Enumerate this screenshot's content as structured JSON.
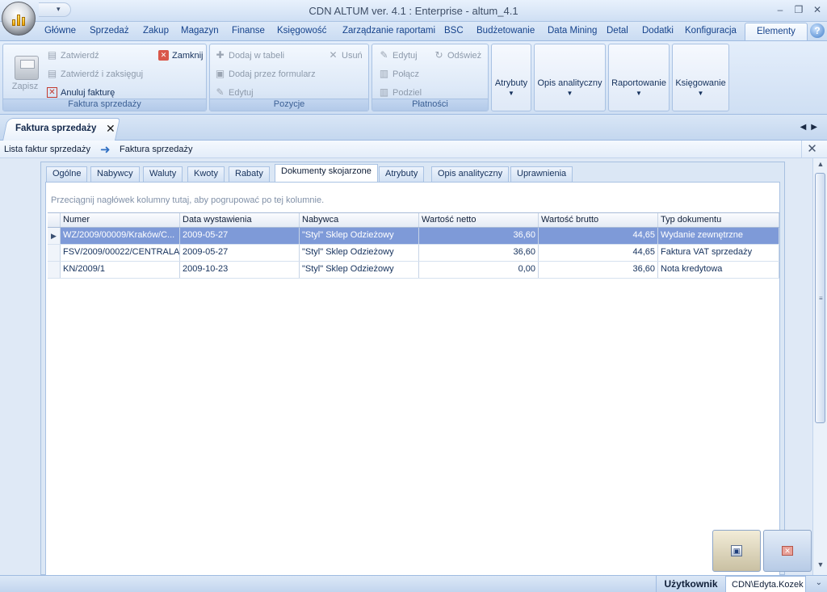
{
  "window": {
    "title": "CDN ALTUM ver. 4.1 : Enterprise - altum_4.1",
    "minimize": "–",
    "restore": "❐",
    "close": "✕"
  },
  "ribbon_tabs": [
    "Główne",
    "Sprzedaż",
    "Zakup",
    "Magazyn",
    "Finanse",
    "Księgowość",
    "Zarządzanie raportami",
    "BSC",
    "Budżetowanie",
    "Data Mining",
    "Detal",
    "Dodatki",
    "Konfiguracja",
    "Elementy"
  ],
  "ribbon_active_tab": "Elementy",
  "help_label": "?",
  "ribbon": {
    "faktura": {
      "label": "Faktura sprzedaży",
      "save": "Zapisz",
      "approve": "Zatwierdź",
      "approve_post": "Zatwierdź i zaksięguj",
      "cancel_invoice": "Anuluj fakturę",
      "close": "Zamknij"
    },
    "pozycje": {
      "label": "Pozycje",
      "add_table": "Dodaj w tabeli",
      "add_form": "Dodaj przez formularz",
      "edit": "Edytuj",
      "delete": "Usuń"
    },
    "platnosci": {
      "label": "Płatności",
      "edit": "Edytuj",
      "refresh": "Odśwież",
      "merge": "Połącz",
      "split": "Podziel"
    },
    "dropdowns": [
      "Atrybuty",
      "Opis analityczny",
      "Raportowanie",
      "Księgowanie"
    ]
  },
  "document_tab": {
    "label": "Faktura sprzedaży",
    "close": "✕"
  },
  "breadcrumb": {
    "parent": "Lista faktur sprzedaży",
    "current": "Faktura sprzedaży",
    "close": "✕"
  },
  "panel_tabs": [
    "Ogólne",
    "Nabywcy",
    "Waluty",
    "Kwoty",
    "Rabaty",
    "Dokumenty skojarzone",
    "Atrybuty",
    "Opis analityczny",
    "Uprawnienia"
  ],
  "panel_active_tab": "Dokumenty skojarzone",
  "grid": {
    "group_hint": "Przeciągnij nagłówek kolumny tutaj, aby pogrupować po tej kolumnie.",
    "columns": [
      "Numer",
      "Data wystawienia",
      "Nabywca",
      "Wartość netto",
      "Wartość brutto",
      "Typ dokumentu"
    ],
    "rows": [
      {
        "numer": "WZ/2009/00009/Kraków/C...",
        "data": "2009-05-27",
        "nabywca": "\"Styl\" Sklep Odzieżowy",
        "netto": "36,60",
        "brutto": "44,65",
        "typ": "Wydanie zewnętrzne",
        "selected": true
      },
      {
        "numer": "FSV/2009/00022/CENTRALA",
        "data": "2009-05-27",
        "nabywca": "\"Styl\" Sklep Odzieżowy",
        "netto": "36,60",
        "brutto": "44,65",
        "typ": "Faktura VAT sprzedaży",
        "selected": false
      },
      {
        "numer": "KN/2009/1",
        "data": "2009-10-23",
        "nabywca": "\"Styl\" Sklep Odzieżowy",
        "netto": "0,00",
        "brutto": "36,60",
        "typ": "Nota kredytowa",
        "selected": false
      }
    ]
  },
  "statusbar": {
    "user_label": "Użytkownik",
    "user_value": "CDN\\Edyta.Kozek"
  },
  "colors": {
    "selected_row": "#7e9ad8",
    "accent": "#15428b"
  }
}
